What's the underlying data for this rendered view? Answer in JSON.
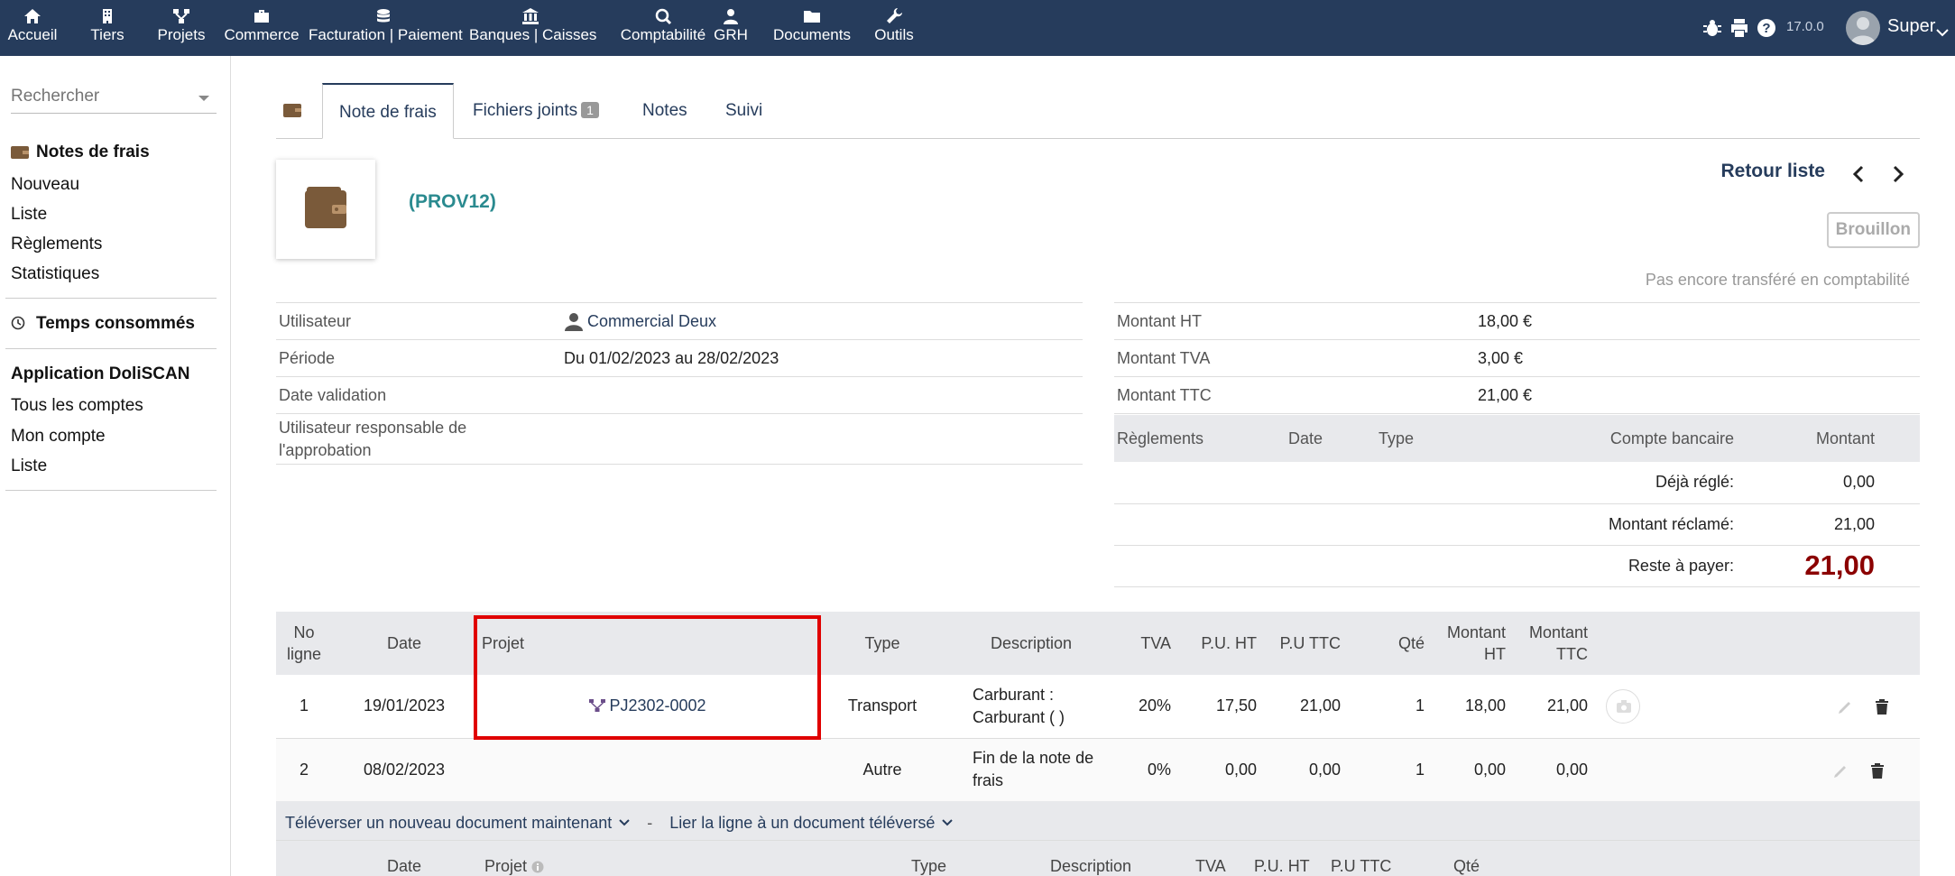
{
  "topbar": {
    "menu": [
      {
        "label": "Accueil",
        "icon": "home-icon"
      },
      {
        "label": "Tiers",
        "icon": "building-icon"
      },
      {
        "label": "Projets",
        "icon": "project-icon"
      },
      {
        "label": "Commerce",
        "icon": "briefcase-icon"
      },
      {
        "label": "Facturation | Paiement",
        "icon": "coins-icon"
      },
      {
        "label": "Banques | Caisses",
        "icon": "bank-icon"
      },
      {
        "label": "Comptabilité",
        "icon": "accounting-icon"
      },
      {
        "label": "GRH",
        "icon": "user-icon"
      },
      {
        "label": "Documents",
        "icon": "folder-icon"
      },
      {
        "label": "Outils",
        "icon": "wrench-icon"
      }
    ],
    "version": "17.0.0",
    "user": "Super",
    "colors": {
      "bar": "#263c5c"
    }
  },
  "sidebar": {
    "search_placeholder": "Rechercher",
    "sections": [
      {
        "title": "Notes de frais",
        "items": [
          "Nouveau",
          "Liste",
          "Règlements",
          "Statistiques"
        ]
      },
      {
        "title": "Temps consommés",
        "items": []
      },
      {
        "title": "Application DoliSCAN",
        "items": [
          "Tous les comptes",
          "Mon compte",
          "Liste"
        ]
      }
    ]
  },
  "tabs": [
    {
      "label": "Note de frais",
      "active": true
    },
    {
      "label": "Fichiers joints",
      "badge": "1"
    },
    {
      "label": "Notes"
    },
    {
      "label": "Suivi"
    }
  ],
  "header": {
    "ref": "(PROV12)",
    "back_list": "Retour liste",
    "status": "Brouillon",
    "not_transferred": "Pas encore transféré en comptabilité"
  },
  "info": [
    {
      "label": "Utilisateur",
      "value": "Commercial Deux"
    },
    {
      "label": "Période",
      "value": "Du 01/02/2023 au 28/02/2023"
    },
    {
      "label": "Date validation",
      "value": ""
    },
    {
      "label": "Utilisateur responsable de l'approbation",
      "value": ""
    }
  ],
  "amounts": [
    {
      "label": "Montant HT",
      "value": "18,00 €"
    },
    {
      "label": "Montant TVA",
      "value": "3,00 €"
    },
    {
      "label": "Montant TTC",
      "value": "21,00 €"
    }
  ],
  "payments": {
    "headers": [
      "Règlements",
      "Date",
      "Type",
      "Compte bancaire",
      "Montant"
    ],
    "already_paid_label": "Déjà réglé:",
    "already_paid": "0,00",
    "claimed_label": "Montant réclamé:",
    "claimed": "21,00",
    "remaining_label": "Reste à payer:",
    "remaining": "21,00"
  },
  "lines": {
    "headers": {
      "no": "No ligne",
      "date": "Date",
      "project": "Projet",
      "type": "Type",
      "description": "Description",
      "vat": "TVA",
      "pu_ht": "P.U. HT",
      "pu_ttc": "P.U TTC",
      "qty": "Qté",
      "total_ht": "Montant HT",
      "total_ttc": "Montant TTC"
    },
    "rows": [
      {
        "no": "1",
        "date": "19/01/2023",
        "project": "PJ2302-0002",
        "type": "Transport",
        "description": "Carburant : Carburant ( )",
        "vat": "20%",
        "pu_ht": "17,50",
        "pu_ttc": "21,00",
        "qty": "1",
        "total_ht": "18,00",
        "total_ttc": "21,00"
      },
      {
        "no": "2",
        "date": "08/02/2023",
        "project": "",
        "type": "Autre",
        "description": "Fin de la note de frais",
        "vat": "0%",
        "pu_ht": "0,00",
        "pu_ttc": "0,00",
        "qty": "1",
        "total_ht": "0,00",
        "total_ttc": "0,00"
      }
    ]
  },
  "upload": {
    "upload_new": "Téléverser un nouveau document maintenant",
    "separator": "-",
    "link_existing": "Lier la ligne à un document téléversé"
  },
  "new_line_headers": {
    "date": "Date",
    "project": "Projet",
    "type": "Type",
    "description": "Description",
    "vat": "TVA",
    "pu_ht": "P.U. HT",
    "pu_ttc": "P.U TTC",
    "qty": "Qté"
  }
}
